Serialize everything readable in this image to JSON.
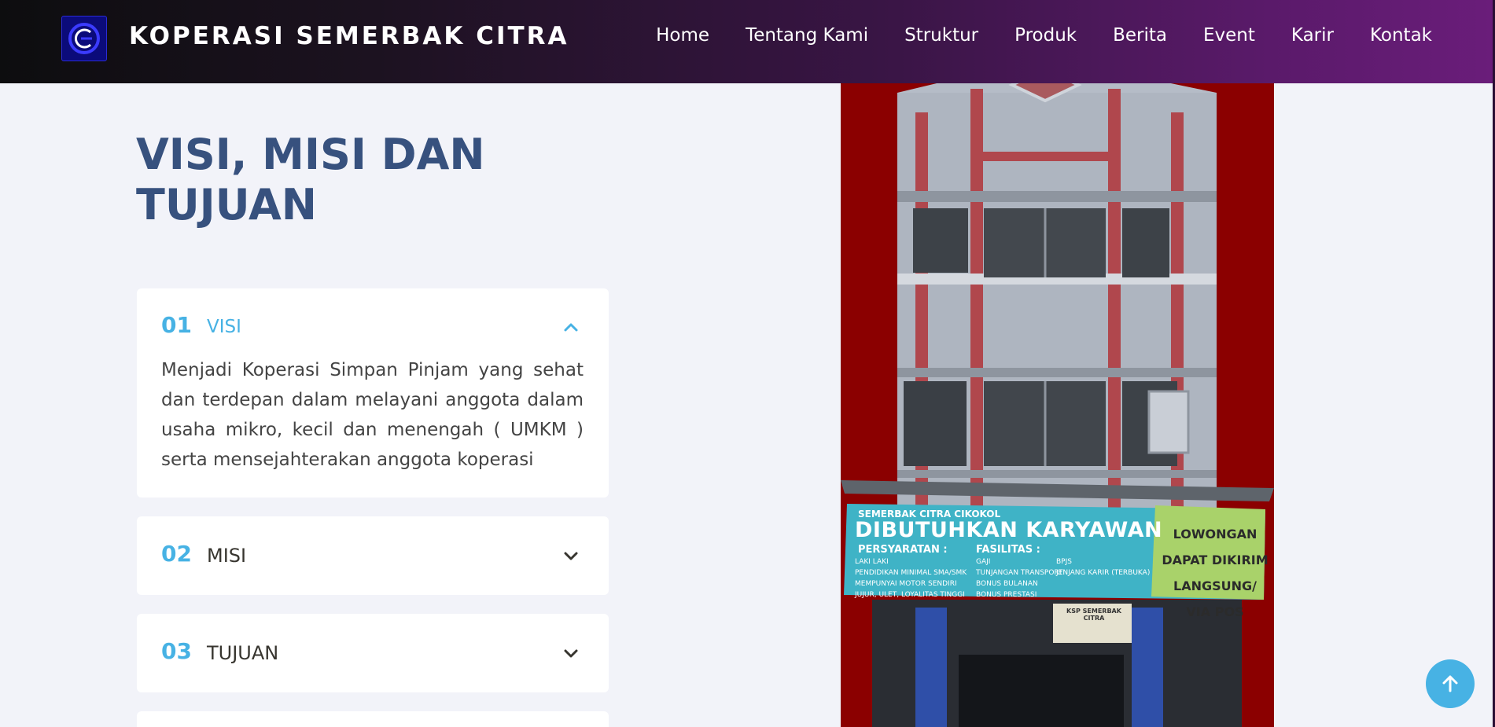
{
  "header": {
    "brand": "KOPERASI SEMERBAK CITRA",
    "logo_icon": "cs-logo-icon",
    "nav": [
      "Home",
      "Tentang Kami",
      "Struktur",
      "Produk",
      "Berita",
      "Event",
      "Karir",
      "Kontak"
    ]
  },
  "section": {
    "title": "VISI, MISI DAN TUJUAN"
  },
  "accordion": [
    {
      "num": "01",
      "label": "VISI",
      "expanded": true,
      "body": "Menjadi Koperasi Simpan Pinjam yang sehat dan terdepan dalam melayani anggota dalam usaha mikro, kecil dan menengah ( UMKM ) serta mensejahterakan anggota koperasi"
    },
    {
      "num": "02",
      "label": "MISI",
      "expanded": false
    },
    {
      "num": "03",
      "label": "TUJUAN",
      "expanded": false
    }
  ],
  "photo": {
    "banner_top": "SEMERBAK CITRA CIKOKOL",
    "banner_title": "DIBUTUHKAN KARYAWAN",
    "requirements_heading": "PERSYARATAN :",
    "requirements": [
      "LAKI LAKI",
      "PENDIDIKAN MINIMAL SMA/SMK",
      "MEMPUNYAI MOTOR SENDIRI",
      "JUJUR, ULET, LOYALITAS TINGGI"
    ],
    "facilities_heading": "FASILITAS :",
    "facilities_a": [
      "GAJI",
      "TUNJANGAN TRANSPORT",
      "BONUS BULANAN",
      "BONUS PRESTASI"
    ],
    "facilities_b": [
      "BPJS",
      "JENJANG KARIR (TERBUKA)"
    ],
    "side_text": [
      "LOWONGAN",
      "DAPAT DIKIRIM",
      "LANGSUNG/ VIA POS"
    ],
    "sign": "KSP SEMERBAK CITRA"
  },
  "colors": {
    "title": "#37517e",
    "accent": "#47b2e4",
    "photo_bg": "#8b0000"
  }
}
